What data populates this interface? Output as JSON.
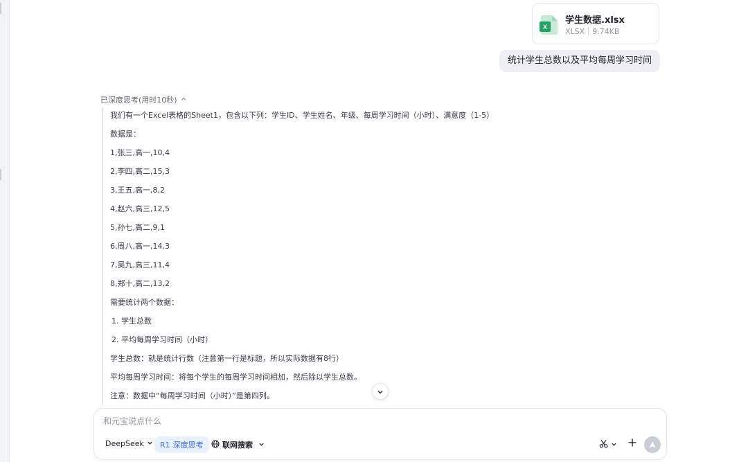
{
  "attachment": {
    "file_name": "学生数据.xlsx",
    "file_type": "XLSX",
    "file_size": "9.74KB",
    "icon": "excel-file-icon",
    "icon_letter": "X"
  },
  "user_message": "统计学生总数以及平均每周学习时间",
  "thinking": {
    "header": "已深度思考(用时10秒)",
    "lines": [
      "我们有一个Excel表格的Sheet1，包含以下列：学生ID、学生姓名、年级、每周学习时间（小时）、满意度（1-5）",
      "数据是：",
      "1,张三,高一,10,4",
      "2,李四,高二,15,3",
      "3,王五,高一,8,2",
      "4,赵六,高三,12,5",
      "5,孙七,高二,9,1",
      "6,周八,高一,14,3",
      "7,吴九,高三,11,4",
      "8,郑十,高二,13,2",
      "需要统计两个数据：",
      "1. 学生总数",
      "2. 平均每周学习时间（小时）",
      "学生总数：就是统计行数（注意第一行是标题，所以实际数据有8行）",
      "平均每周学习时间：将每个学生的每周学习时间相加，然后除以学生总数。",
      "注意：数据中“每周学习时间（小时）”是第四列。"
    ]
  },
  "composer": {
    "placeholder": "和元宝说点什么",
    "model_label": "DeepSeek",
    "deep_think_badge": "R1",
    "deep_think_label": "深度思考",
    "web_search_label": "联网搜索"
  },
  "colors": {
    "accent": "#3d6bf5",
    "accent_bg": "#e8f1ff",
    "bubble_bg": "#eeeff2",
    "excel_green": "#21a366"
  }
}
